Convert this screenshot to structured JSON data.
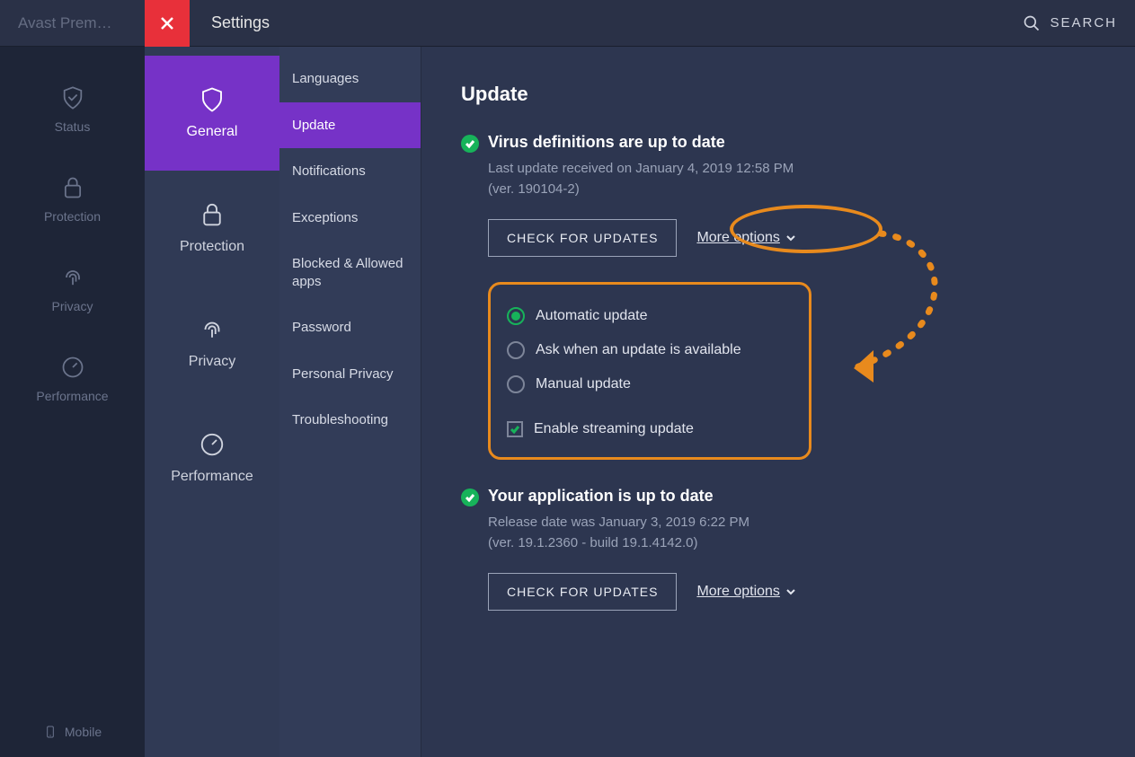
{
  "app": {
    "name": "Avast Prem…"
  },
  "header": {
    "title": "Settings",
    "search_label": "SEARCH"
  },
  "left_rail": {
    "items": [
      {
        "label": "Status"
      },
      {
        "label": "Protection"
      },
      {
        "label": "Privacy"
      },
      {
        "label": "Performance"
      }
    ],
    "mobile_label": "Mobile"
  },
  "col1": {
    "tabs": [
      {
        "label": "General"
      },
      {
        "label": "Protection"
      },
      {
        "label": "Privacy"
      },
      {
        "label": "Performance"
      }
    ]
  },
  "col2": {
    "items": [
      "Languages",
      "Update",
      "Notifications",
      "Exceptions",
      "Blocked & Allowed apps",
      "Password",
      "Personal Privacy",
      "Troubleshooting"
    ]
  },
  "content": {
    "page_title": "Update",
    "virus": {
      "title": "Virus definitions are up to date",
      "sub1": "Last update received on January 4, 2019 12:58 PM",
      "sub2": "(ver. 190104-2)",
      "check_btn": "CHECK FOR UPDATES",
      "more": "More options"
    },
    "options": {
      "r1": "Automatic update",
      "r2": "Ask when an update is available",
      "r3": "Manual update",
      "cb": "Enable streaming update"
    },
    "app_sec": {
      "title": "Your application is up to date",
      "sub1": "Release date was January 3, 2019 6:22 PM",
      "sub2": "(ver. 19.1.2360 - build 19.1.4142.0)",
      "check_btn": "CHECK FOR UPDATES",
      "more": "More options"
    }
  }
}
